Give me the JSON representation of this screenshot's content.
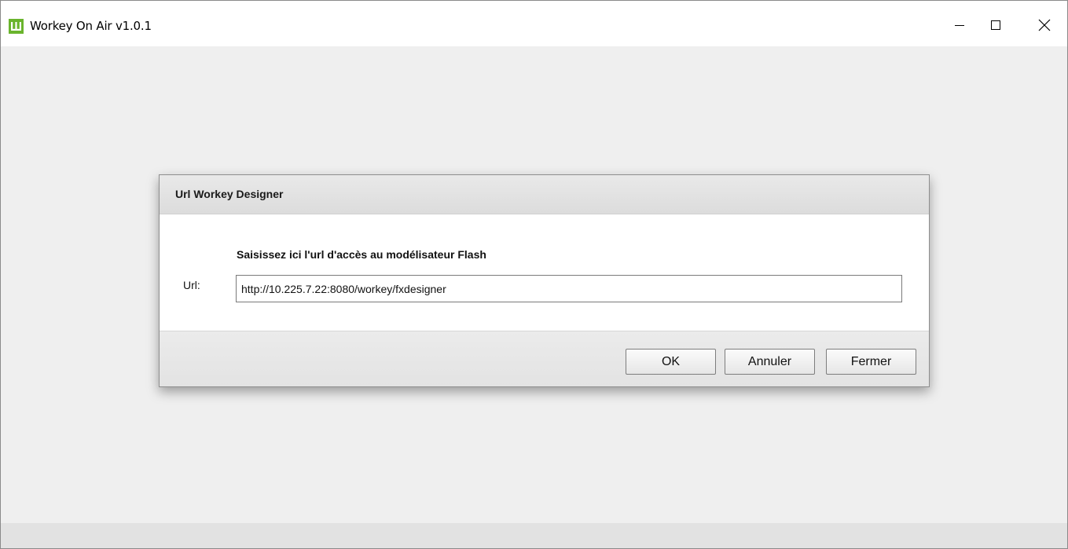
{
  "window": {
    "title": "Workey On Air v1.0.1",
    "icon": "workey-logo-icon",
    "accent_color": "#6ab42d",
    "controls": [
      "minimize-icon",
      "maximize-icon",
      "close-icon"
    ]
  },
  "dialog": {
    "title": "Url Workey Designer",
    "instruction": "Saisissez ici l'url d'accès au modélisateur Flash",
    "url_label": "Url:",
    "url_value": "http://10.225.7.22:8080/workey/fxdesigner",
    "buttons": {
      "ok": "OK",
      "cancel": "Annuler",
      "close": "Fermer"
    }
  }
}
